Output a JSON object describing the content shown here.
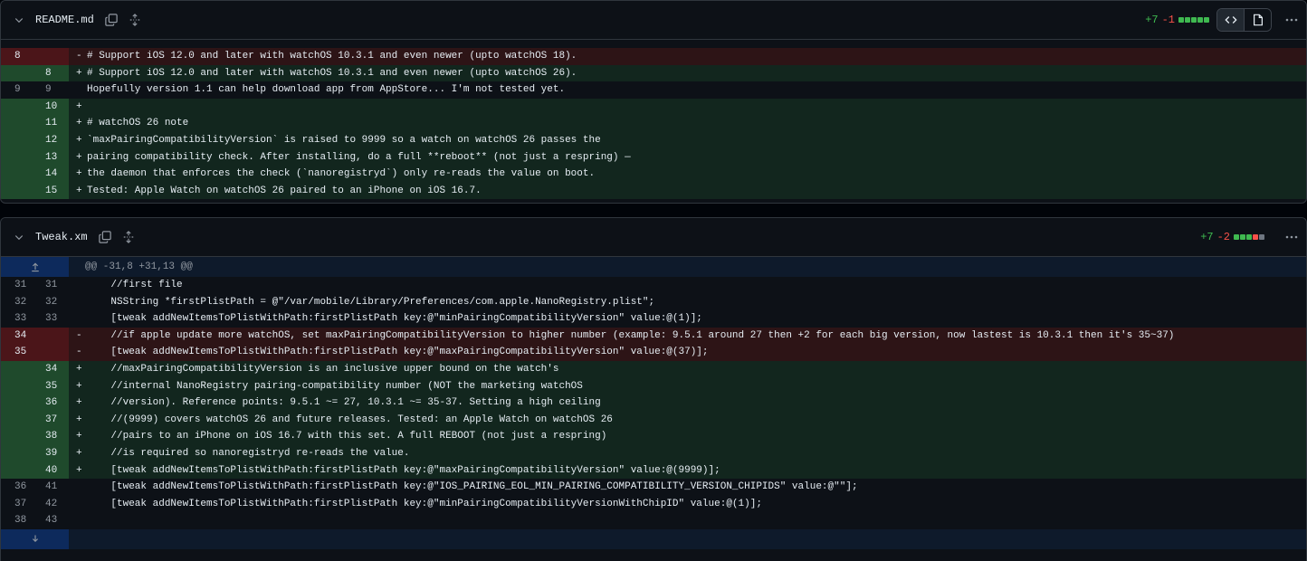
{
  "files": [
    {
      "name": "README.md",
      "additions": "+7",
      "deletions": "-1",
      "blocks": [
        "#3fb950",
        "#3fb950",
        "#3fb950",
        "#3fb950",
        "#3fb950"
      ],
      "rows": [
        {
          "type": "del",
          "old": "8",
          "new": "",
          "mark": "-",
          "code": "# Support iOS 12.0 and later with watchOS 10.3.1 and even newer (upto watchOS 18)."
        },
        {
          "type": "add",
          "old": "",
          "new": "8",
          "mark": "+",
          "code": "# Support iOS 12.0 and later with watchOS 10.3.1 and even newer (upto watchOS 26)."
        },
        {
          "type": "ctx",
          "old": "9",
          "new": "9",
          "mark": "",
          "code": "Hopefully version 1.1 can help download app from AppStore... I'm not tested yet."
        },
        {
          "type": "add",
          "old": "",
          "new": "10",
          "mark": "+",
          "code": ""
        },
        {
          "type": "add",
          "old": "",
          "new": "11",
          "mark": "+",
          "code": "# watchOS 26 note"
        },
        {
          "type": "add",
          "old": "",
          "new": "12",
          "mark": "+",
          "code": "`maxPairingCompatibilityVersion` is raised to 9999 so a watch on watchOS 26 passes the"
        },
        {
          "type": "add",
          "old": "",
          "new": "13",
          "mark": "+",
          "code": "pairing compatibility check. After installing, do a full **reboot** (not just a respring) —"
        },
        {
          "type": "add",
          "old": "",
          "new": "14",
          "mark": "+",
          "code": "the daemon that enforces the check (`nanoregistryd`) only re-reads the value on boot."
        },
        {
          "type": "add",
          "old": "",
          "new": "15",
          "mark": "+",
          "code": "Tested: Apple Watch on watchOS 26 paired to an iPhone on iOS 16.7."
        }
      ]
    },
    {
      "name": "Tweak.xm",
      "additions": "+7",
      "deletions": "-2",
      "blocks": [
        "#3fb950",
        "#3fb950",
        "#3fb950",
        "#f85149",
        "#6e7681"
      ],
      "hunk": "@@ -31,8 +31,13 @@",
      "rows": [
        {
          "type": "ctx",
          "old": "31",
          "new": "31",
          "mark": "",
          "code": "    //first file"
        },
        {
          "type": "ctx",
          "old": "32",
          "new": "32",
          "mark": "",
          "code": "    NSString *firstPlistPath = @\"/var/mobile/Library/Preferences/com.apple.NanoRegistry.plist\";"
        },
        {
          "type": "ctx",
          "old": "33",
          "new": "33",
          "mark": "",
          "code": "    [tweak addNewItemsToPlistWithPath:firstPlistPath key:@\"minPairingCompatibilityVersion\" value:@(1)];"
        },
        {
          "type": "del",
          "old": "34",
          "new": "",
          "mark": "-",
          "code": "    //if apple update more watchOS, set maxPairingCompatibilityVersion to higher number (example: 9.5.1 around 27 then +2 for each big version, now lastest is 10.3.1 then it's 35~37)"
        },
        {
          "type": "del",
          "old": "35",
          "new": "",
          "mark": "-",
          "code": "    [tweak addNewItemsToPlistWithPath:firstPlistPath key:@\"maxPairingCompatibilityVersion\" value:@(37)];"
        },
        {
          "type": "add",
          "old": "",
          "new": "34",
          "mark": "+",
          "code": "    //maxPairingCompatibilityVersion is an inclusive upper bound on the watch's"
        },
        {
          "type": "add",
          "old": "",
          "new": "35",
          "mark": "+",
          "code": "    //internal NanoRegistry pairing-compatibility number (NOT the marketing watchOS"
        },
        {
          "type": "add",
          "old": "",
          "new": "36",
          "mark": "+",
          "code": "    //version). Reference points: 9.5.1 ~= 27, 10.3.1 ~= 35-37. Setting a high ceiling"
        },
        {
          "type": "add",
          "old": "",
          "new": "37",
          "mark": "+",
          "code": "    //(9999) covers watchOS 26 and future releases. Tested: an Apple Watch on watchOS 26"
        },
        {
          "type": "add",
          "old": "",
          "new": "38",
          "mark": "+",
          "code": "    //pairs to an iPhone on iOS 16.7 with this set. A full REBOOT (not just a respring)"
        },
        {
          "type": "add",
          "old": "",
          "new": "39",
          "mark": "+",
          "code": "    //is required so nanoregistryd re-reads the value."
        },
        {
          "type": "add",
          "old": "",
          "new": "40",
          "mark": "+",
          "code": "    [tweak addNewItemsToPlistWithPath:firstPlistPath key:@\"maxPairingCompatibilityVersion\" value:@(9999)];"
        },
        {
          "type": "ctx",
          "old": "36",
          "new": "41",
          "mark": "",
          "code": "    [tweak addNewItemsToPlistWithPath:firstPlistPath key:@\"IOS_PAIRING_EOL_MIN_PAIRING_COMPATIBILITY_VERSION_CHIPIDS\" value:@\"\"];"
        },
        {
          "type": "ctx",
          "old": "37",
          "new": "42",
          "mark": "",
          "code": "    [tweak addNewItemsToPlistWithPath:firstPlistPath key:@\"minPairingCompatibilityVersionWithChipID\" value:@(1)];"
        },
        {
          "type": "ctx",
          "old": "38",
          "new": "43",
          "mark": "",
          "code": ""
        }
      ]
    }
  ]
}
